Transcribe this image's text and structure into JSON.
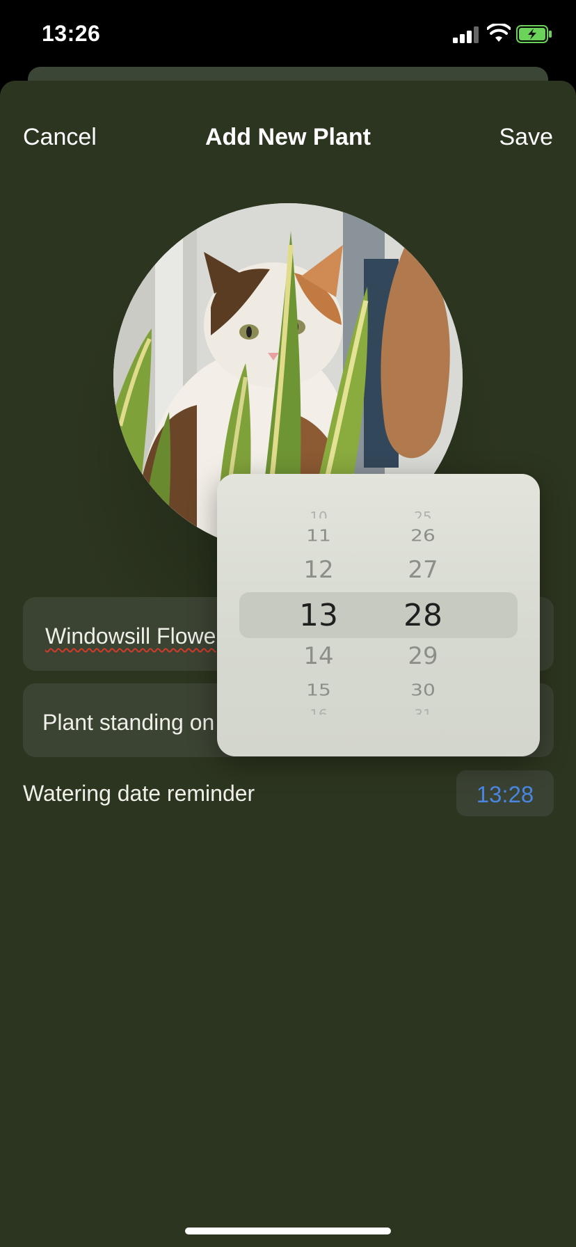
{
  "status_bar": {
    "time": "13:26",
    "icons": [
      "signal-icon",
      "wifi-icon",
      "battery-charging-icon"
    ],
    "battery_color": "#6cd35a"
  },
  "nav": {
    "cancel_label": "Cancel",
    "title": "Add New Plant",
    "save_label": "Save"
  },
  "photo": {
    "subject": "cat-with-snake-plant-photo"
  },
  "form": {
    "name_value": "Windowsill Flowe",
    "description_value": "Plant standing on",
    "reminder_label": "Watering date reminder",
    "reminder_time": "13:28",
    "accent_color": "#4a86e0"
  },
  "time_picker": {
    "hours": [
      "10",
      "11",
      "12",
      "13",
      "14",
      "15",
      "16"
    ],
    "minutes": [
      "25",
      "26",
      "27",
      "28",
      "29",
      "30",
      "31"
    ],
    "selected_hour": "13",
    "selected_minute": "28"
  }
}
